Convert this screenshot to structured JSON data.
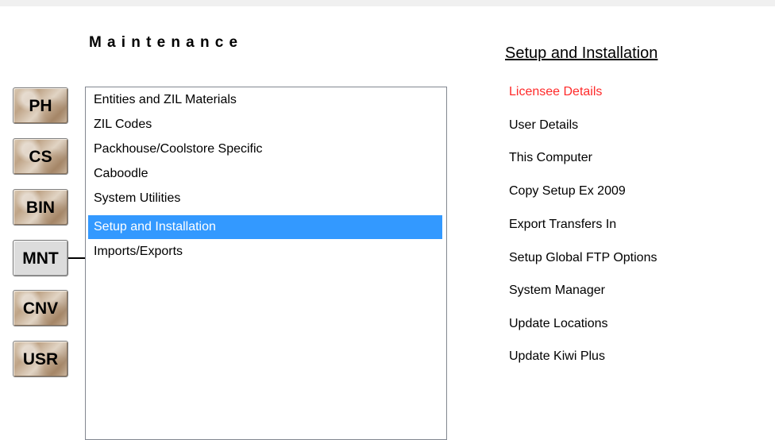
{
  "section": {
    "title": "Maintenance"
  },
  "modules": [
    {
      "label": "PH"
    },
    {
      "label": "CS"
    },
    {
      "label": "BIN"
    },
    {
      "label": "MNT"
    },
    {
      "label": "CNV"
    },
    {
      "label": "USR"
    }
  ],
  "categories": {
    "items": [
      {
        "label": "Entities and ZIL Materials"
      },
      {
        "label": "ZIL Codes"
      },
      {
        "label": "Packhouse/Coolstore Specific"
      },
      {
        "label": "Caboodle"
      },
      {
        "label": "System Utilities"
      },
      {
        "label": "Setup and Installation"
      },
      {
        "label": "Imports/Exports"
      }
    ],
    "selected": "Setup and Installation"
  },
  "menu": {
    "title": "Setup and Installation",
    "items": [
      {
        "label": "Licensee Details"
      },
      {
        "label": "User Details"
      },
      {
        "label": "This Computer"
      },
      {
        "label": "Copy Setup Ex 2009"
      },
      {
        "label": "Export Transfers In"
      },
      {
        "label": "Setup Global FTP Options"
      },
      {
        "label": "System Manager"
      },
      {
        "label": "Update Locations"
      },
      {
        "label": "Update Kiwi Plus"
      }
    ]
  },
  "colors": {
    "selection": "#3399ff",
    "highlight_link": "#ff2a2a",
    "active_module": "#dcdcdc"
  }
}
